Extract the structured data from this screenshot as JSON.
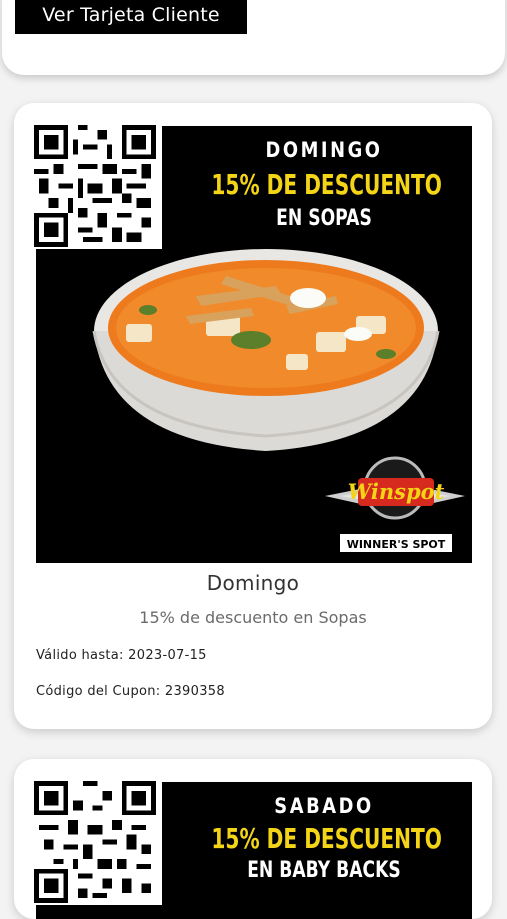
{
  "top": {
    "button_label": "Ver Tarjeta Cliente"
  },
  "coupons": [
    {
      "promo": {
        "day": "DOMINGO",
        "discount": "15% DE DESCUENTO",
        "item": "EN SOPAS",
        "brand": "Winspot",
        "brand_sub": "WINNER'S SPOT"
      },
      "title": "Domingo",
      "subtitle": "15% de descuento en Sopas",
      "valid_label": "Válido hasta:",
      "valid_value": "2023-07-15",
      "code_label": "Código del Cupon:",
      "code_value": "2390358"
    },
    {
      "promo": {
        "day": "SABADO",
        "discount": "15% DE DESCUENTO",
        "item": "EN BABY BACKS"
      }
    }
  ],
  "colors": {
    "accent": "#f4d417",
    "button_bg": "#000000",
    "brand_red": "#d62a1e"
  },
  "icons": [
    "qr-code-icon"
  ]
}
